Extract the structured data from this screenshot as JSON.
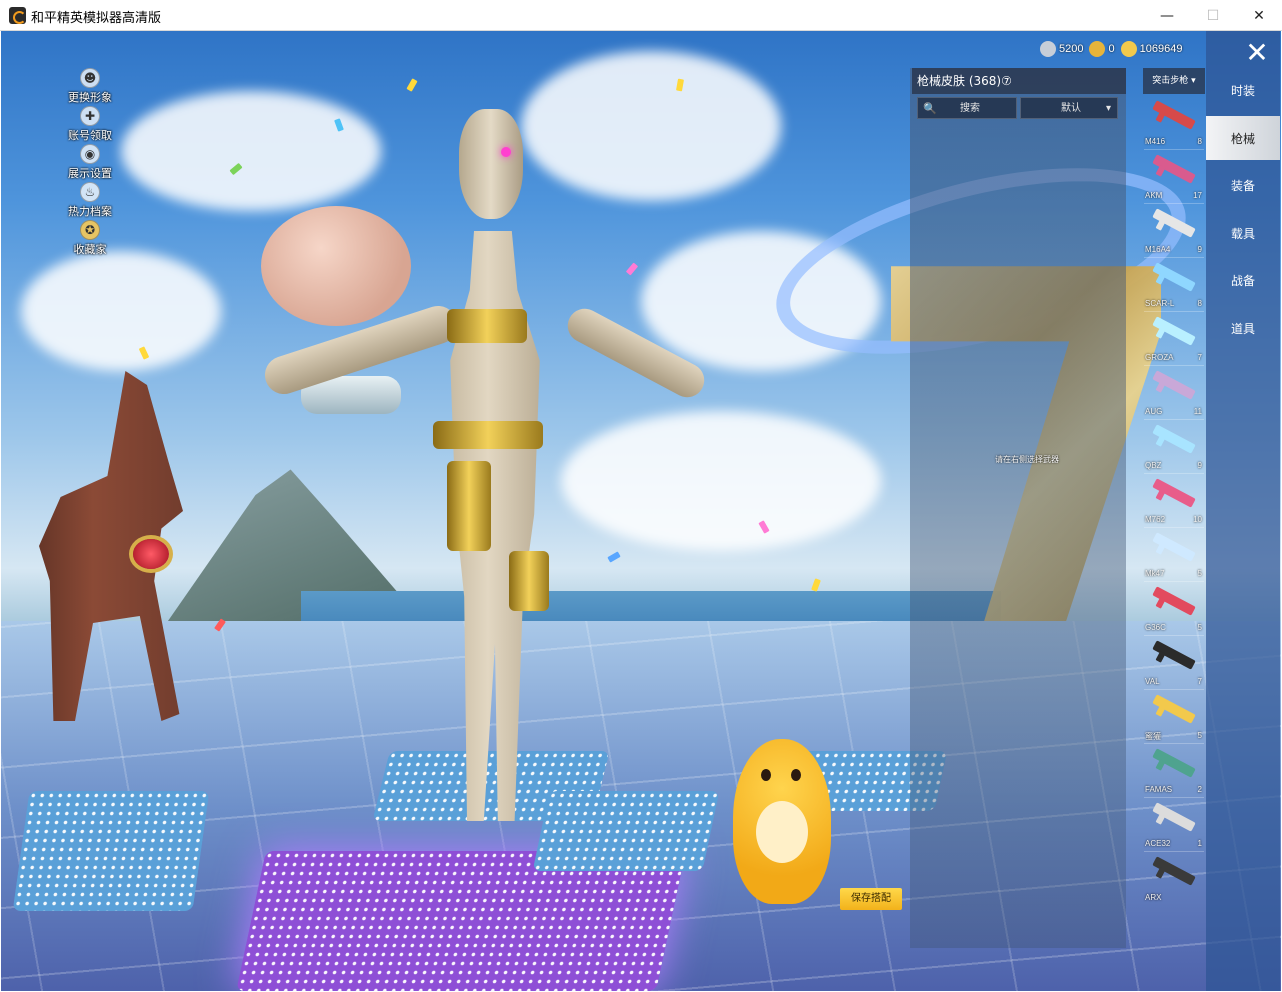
{
  "window": {
    "title": "和平精英模拟器高清版",
    "minimize_glyph": "—",
    "maximize_glyph": "☐",
    "close_glyph": "✕"
  },
  "left_menu": [
    {
      "label": "更换形象",
      "icon": "person-icon"
    },
    {
      "label": "账号领取",
      "icon": "gamepad-icon"
    },
    {
      "label": "展示设置",
      "icon": "eye-icon"
    },
    {
      "label": "热力档案",
      "icon": "flame-icon"
    },
    {
      "label": "收藏家",
      "icon": "medal-icon"
    }
  ],
  "currencies": [
    {
      "value": "5200",
      "icon": "coin-silver-icon",
      "color": "#c7ced8"
    },
    {
      "value": "0",
      "icon": "a-token-icon",
      "color": "#e7b43a"
    },
    {
      "value": "1069649",
      "icon": "gold-coin-icon",
      "color": "#f2c94c"
    }
  ],
  "categories": [
    {
      "label": "时装",
      "active": false
    },
    {
      "label": "枪械",
      "active": true
    },
    {
      "label": "装备",
      "active": false
    },
    {
      "label": "载具",
      "active": false
    },
    {
      "label": "战备",
      "active": false
    },
    {
      "label": "道具",
      "active": false
    }
  ],
  "close_glyph": "✕",
  "skin_panel": {
    "title": "枪械皮肤 (368)⑦",
    "search_placeholder": "搜索",
    "search_icon": "🔍",
    "sort_value": "默认",
    "sort_chevron": "▾",
    "hint": "请在右侧选择武器",
    "weapon_filter": "突击步枪 ▾"
  },
  "weapons": [
    {
      "name": "M416",
      "count": "8",
      "color": "#d74a4a"
    },
    {
      "name": "AKM",
      "count": "17",
      "color": "#d95b8e"
    },
    {
      "name": "M16A4",
      "count": "9",
      "color": "#e6e6e6"
    },
    {
      "name": "SCAR-L",
      "count": "8",
      "color": "#8fd7ff"
    },
    {
      "name": "GROZA",
      "count": "7",
      "color": "#b9f0ff"
    },
    {
      "name": "AUG",
      "count": "11",
      "color": "#c9a8d8"
    },
    {
      "name": "QBZ",
      "count": "9",
      "color": "#a8e4ff"
    },
    {
      "name": "M762",
      "count": "10",
      "color": "#e85d8a"
    },
    {
      "name": "Mk47",
      "count": "5",
      "color": "#cfe9ff"
    },
    {
      "name": "G36C",
      "count": "5",
      "color": "#e24a5e"
    },
    {
      "name": "VAL",
      "count": "7",
      "color": "#2b2b2b"
    },
    {
      "name": "蜜獾",
      "count": "5",
      "color": "#f2c94c"
    },
    {
      "name": "FAMAS",
      "count": "2",
      "color": "#4fa38f"
    },
    {
      "name": "ACE32",
      "count": "1",
      "color": "#dcdcdc"
    },
    {
      "name": "ARX",
      "count": "",
      "color": "#3a3a3a"
    }
  ],
  "save_button": "保存搭配"
}
